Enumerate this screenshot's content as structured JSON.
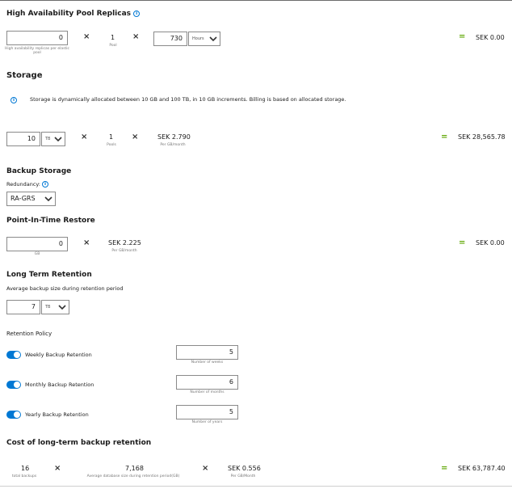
{
  "ha": {
    "title": "High Availability Pool Replicas",
    "replicas_value": "0",
    "replicas_caption": "High availability replicas per elastic pool",
    "pool_count": "1",
    "pool_caption": "Pool",
    "hours_value": "730",
    "hours_unit": "Hours",
    "result": "SEK 0.00"
  },
  "storage": {
    "title": "Storage",
    "info": "Storage is dynamically allocated between 10 GB and 100 TB, in 10 GB increments. Billing is based on allocated storage.",
    "size_value": "10",
    "size_unit": "TB",
    "pools_value": "1",
    "pools_caption": "Pools",
    "price": "SEK 2.790",
    "price_caption": "Per GB/month",
    "result": "SEK 28,565.78"
  },
  "backup": {
    "title": "Backup Storage",
    "redundancy_label": "Redundancy:",
    "redundancy_value": "RA-GRS"
  },
  "pitr": {
    "title": "Point-In-Time Restore",
    "value": "0",
    "caption": "GB",
    "price": "SEK 2.225",
    "price_caption": "Per GB/month",
    "result": "SEK 0.00"
  },
  "ltr": {
    "title": "Long Term Retention",
    "avg_label": "Average backup size during retention period",
    "avg_value": "7",
    "avg_unit": "TB"
  },
  "policy": {
    "title": "Retention Policy",
    "weekly_label": "Weekly Backup Retention",
    "weekly_value": "5",
    "weekly_caption": "Number of weeks",
    "monthly_label": "Monthly Backup Retention",
    "monthly_value": "6",
    "monthly_caption": "Number of months",
    "yearly_label": "Yearly Backup Retention",
    "yearly_value": "5",
    "yearly_caption": "Number of years"
  },
  "cost": {
    "title": "Cost of long-term backup retention",
    "total_backups": "16",
    "total_backups_caption": "total backups",
    "avg_size": "7,168",
    "avg_size_caption": "Average database size during retention period(GB)",
    "price": "SEK 0.556",
    "price_caption": "Per GB/Month",
    "result": "SEK 63,787.40"
  },
  "symbols": {
    "times": "×",
    "equals": "=",
    "info": "i"
  }
}
